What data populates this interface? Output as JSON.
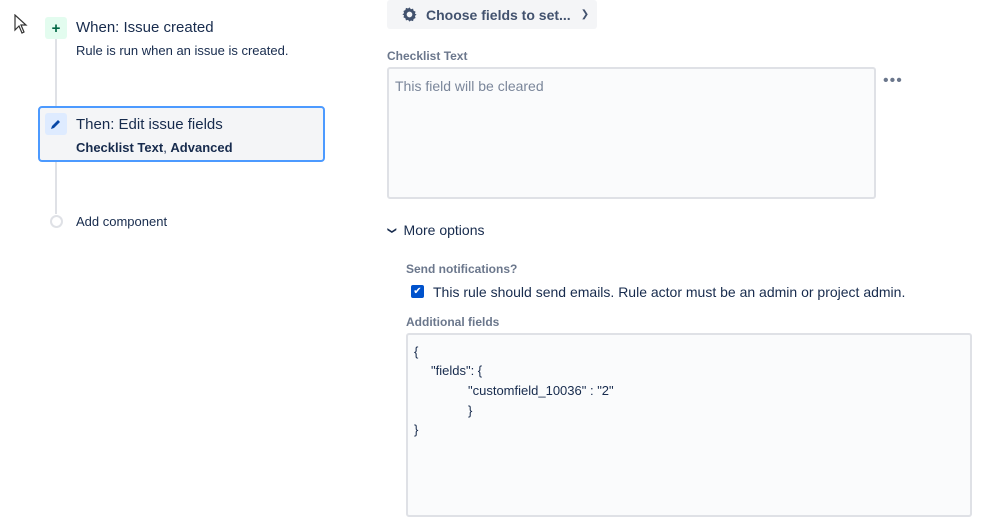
{
  "rule": {
    "trigger": {
      "title": "When: Issue created",
      "description": "Rule is run when an issue is created.",
      "icon": "plus-icon"
    },
    "action": {
      "title": "Then: Edit issue fields",
      "field1": "Checklist Text",
      "sep": ", ",
      "field2": "Advanced",
      "icon": "pencil-icon"
    },
    "add_component": "Add component"
  },
  "editor": {
    "choose_fields": "Choose fields to set...",
    "checklist_label": "Checklist Text",
    "checklist_placeholder": "This field will be cleared",
    "more_options": "More options",
    "send_notifications_label": "Send notifications?",
    "send_emails_text": "This rule should send emails. Rule actor must be an admin or project admin.",
    "send_emails_checked": true,
    "additional_fields_label": "Additional fields",
    "additional_fields_lines": [
      "{",
      "\"fields\": {",
      "\"customfield_10036\" : \"2\"",
      "}",
      "}"
    ]
  },
  "colors": {
    "accent": "#0052cc",
    "selected_border": "#4c9aff",
    "trigger_bg": "#e3fcef"
  }
}
